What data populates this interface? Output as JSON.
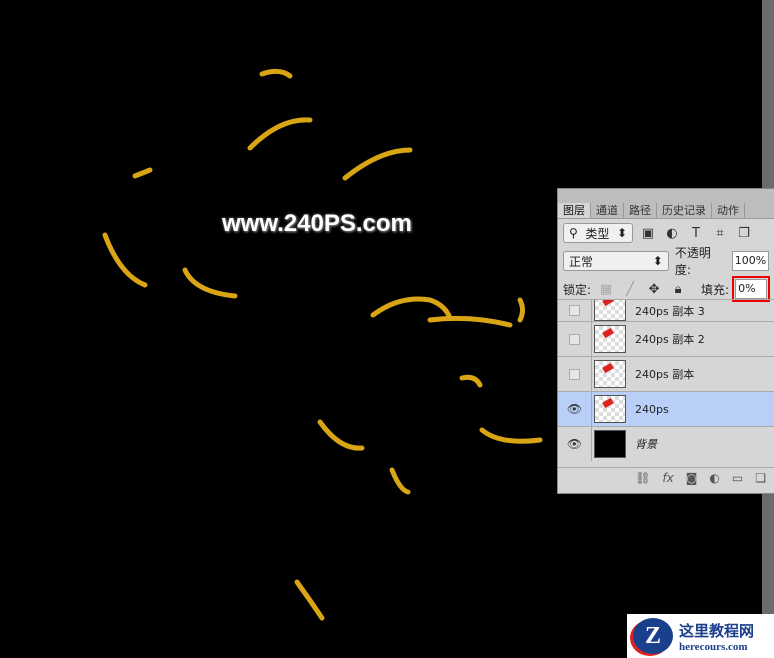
{
  "watermark": "www.240PS.com",
  "panel": {
    "tabs": [
      "图层",
      "通道",
      "路径",
      "历史记录",
      "动作"
    ],
    "filter": {
      "label": "类型",
      "icon": "search-icon"
    },
    "blend_mode": "正常",
    "opacity_label": "不透明度:",
    "opacity_value": "100%",
    "lock_label": "锁定:",
    "fill_label": "填充:",
    "fill_value": "0%",
    "layers": [
      {
        "name": "240ps 副本 3",
        "visible": false
      },
      {
        "name": "240ps 副本 2",
        "visible": false
      },
      {
        "name": "240ps 副本",
        "visible": false
      },
      {
        "name": "240ps",
        "visible": true,
        "selected": true
      },
      {
        "name": "背景",
        "visible": true
      }
    ]
  },
  "logo": {
    "title": "这里教程网",
    "url": "herecours.com"
  },
  "colors": {
    "stroke": "#d9a514",
    "selection": "#b9cff7",
    "highlight": "#e00000"
  }
}
